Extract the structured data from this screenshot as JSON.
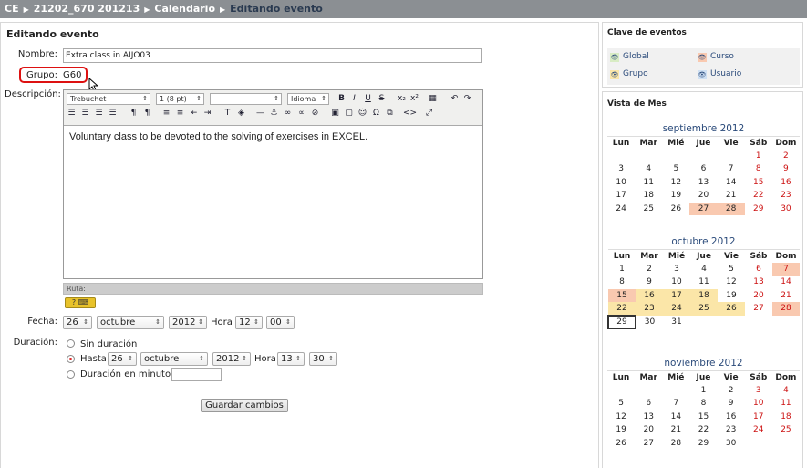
{
  "breadcrumb": [
    "CE",
    "21202_670 201213",
    "Calendario",
    "Editando evento"
  ],
  "page_title": "Editando evento",
  "form": {
    "name_label": "Nombre:",
    "name_value": "Extra class in AIJO03",
    "group_label": "Grupo:",
    "group_value": "G60",
    "description_label": "Descripción:",
    "description_text": "Voluntary class to be devoted to the solving of exercises in EXCEL.",
    "toolbar": {
      "font_family": "Trebuchet",
      "font_size": "1 (8 pt)",
      "format": "",
      "language": "Idioma",
      "bold": "B",
      "italic": "I",
      "underline": "U",
      "strike": "S"
    },
    "path_label": "Ruta:",
    "date_label": "Fecha:",
    "date_day": "26",
    "date_month": "octubre",
    "date_year": "2012",
    "hour_label": "Hora",
    "date_hour": "12",
    "date_minute": "00",
    "duration_label": "Duración:",
    "duration_none": "Sin duración",
    "duration_until": "Hasta",
    "until_day": "26",
    "until_month": "octubre",
    "until_year": "2012",
    "until_hour": "13",
    "until_minute": "30",
    "duration_minutes": "Duración en minutos:",
    "save_label": "Guardar cambios"
  },
  "sidebar": {
    "legend_title": "Clave de eventos",
    "legend": [
      {
        "label": "Global",
        "color": "#d8ecc4"
      },
      {
        "label": "Curso",
        "color": "#f9c9b0"
      },
      {
        "label": "Grupo",
        "color": "#fbe6a8"
      },
      {
        "label": "Usuario",
        "color": "#cfe0f3"
      }
    ],
    "month_view_title": "Vista de Mes",
    "weekdays": [
      "Lun",
      "Mar",
      "Mié",
      "Jue",
      "Vie",
      "Sáb",
      "Dom"
    ],
    "months": [
      {
        "name": "septiembre 2012",
        "weeks": [
          [
            "",
            "",
            "",
            "",
            "",
            "1",
            "2"
          ],
          [
            "3",
            "4",
            "5",
            "6",
            "7",
            "8",
            "9"
          ],
          [
            "10",
            "11",
            "12",
            "13",
            "14",
            "15",
            "16"
          ],
          [
            "17",
            "18",
            "19",
            "20",
            "21",
            "22",
            "23"
          ],
          [
            "24",
            "25",
            "26",
            "27",
            "28",
            "29",
            "30"
          ]
        ]
      },
      {
        "name": "octubre 2012",
        "weeks": [
          [
            "1",
            "2",
            "3",
            "4",
            "5",
            "6",
            "7"
          ],
          [
            "8",
            "9",
            "10",
            "11",
            "12",
            "13",
            "14"
          ],
          [
            "15",
            "16",
            "17",
            "18",
            "19",
            "20",
            "21"
          ],
          [
            "22",
            "23",
            "24",
            "25",
            "26",
            "27",
            "28"
          ],
          [
            "29",
            "30",
            "31",
            "",
            "",
            "",
            ""
          ]
        ]
      },
      {
        "name": "noviembre 2012",
        "weeks": [
          [
            "",
            "",
            "",
            "1",
            "2",
            "3",
            "4"
          ],
          [
            "5",
            "6",
            "7",
            "8",
            "9",
            "10",
            "11"
          ],
          [
            "12",
            "13",
            "14",
            "15",
            "16",
            "17",
            "18"
          ],
          [
            "19",
            "20",
            "21",
            "22",
            "23",
            "24",
            "25"
          ],
          [
            "26",
            "27",
            "28",
            "29",
            "30",
            "",
            ""
          ]
        ]
      }
    ]
  }
}
